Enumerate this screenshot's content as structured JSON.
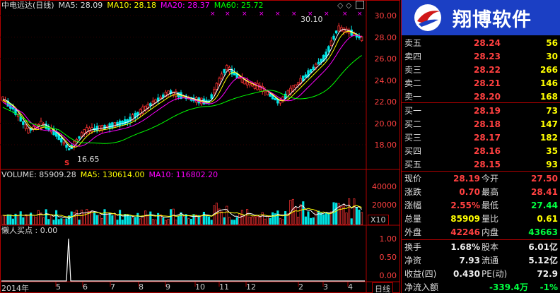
{
  "header": {
    "stock_name": "中电远达(日线)",
    "ma5": "MA5: 28.09",
    "ma10": "MA10: 28.18",
    "ma20": "MA20: 28.37",
    "ma60": "MA60: 25.72"
  },
  "price_axis": [
    "30.00",
    "28.00",
    "26.00",
    "24.00",
    "22.00",
    "20.00",
    "18.00"
  ],
  "annotations": {
    "high": "30.10",
    "low": "16.65",
    "marker": "S"
  },
  "volume_header": {
    "volume": "VOLUME: 85909.28",
    "ma5": "MA5: 130614.00",
    "ma10": "MA10: 116802.20"
  },
  "volume_axis": [
    "40000",
    "20000"
  ],
  "x10_tab": "X10",
  "indicator_header": "懒人买点 : 0.00",
  "indicator_axis": [
    "1.00",
    "0.50",
    "0.00"
  ],
  "time_axis": [
    "2014年",
    "5",
    "6",
    "7",
    "8",
    "9",
    "10",
    "11",
    "12",
    "2",
    "3",
    "4"
  ],
  "daily_tab": "日线",
  "logo_text": "翔博软件",
  "order_book": {
    "asks": [
      {
        "label": "卖五",
        "price": "28.24",
        "volume": "56"
      },
      {
        "label": "卖四",
        "price": "28.23",
        "volume": "30"
      },
      {
        "label": "卖三",
        "price": "28.22",
        "volume": "266"
      },
      {
        "label": "卖二",
        "price": "28.21",
        "volume": "146"
      },
      {
        "label": "卖一",
        "price": "28.20",
        "volume": "168"
      }
    ],
    "bids": [
      {
        "label": "买一",
        "price": "28.19",
        "volume": "73"
      },
      {
        "label": "买二",
        "price": "28.18",
        "volume": "147"
      },
      {
        "label": "买三",
        "price": "28.17",
        "volume": "182"
      },
      {
        "label": "买四",
        "price": "28.16",
        "volume": "35"
      },
      {
        "label": "买五",
        "price": "28.15",
        "volume": "93"
      }
    ]
  },
  "quote": [
    {
      "l1": "现价",
      "v1": "28.19",
      "c1": "red",
      "l2": "今开",
      "v2": "27.50",
      "c2": "red"
    },
    {
      "l1": "涨跌",
      "v1": "0.70",
      "c1": "red",
      "l2": "最高",
      "v2": "28.41",
      "c2": "red"
    },
    {
      "l1": "涨幅",
      "v1": "2.55%",
      "c1": "red",
      "l2": "最低",
      "v2": "27.44",
      "c2": "grn"
    },
    {
      "l1": "总量",
      "v1": "85909",
      "c1": "yel",
      "l2": "量比",
      "v2": "0.61",
      "c2": "yel"
    },
    {
      "l1": "外盘",
      "v1": "42246",
      "c1": "red",
      "l2": "内盘",
      "v2": "43663",
      "c2": "grn"
    }
  ],
  "fundamentals": [
    {
      "l1": "换手",
      "v1": "1.68%",
      "l2": "股本",
      "v2": "6.01亿"
    },
    {
      "l1": "净资",
      "v1": "7.93",
      "l2": "流通",
      "v2": "5.12亿"
    },
    {
      "l1": "收益(四)",
      "v1": "0.430",
      "l2": "PE(动)",
      "v2": "72.9"
    }
  ],
  "net_inflow": {
    "label": "净流入额",
    "value": "-339.4万",
    "pct": "-1%"
  },
  "colors": {
    "up": "#ff4040",
    "down": "#00ffff",
    "ma5": "#ffffff",
    "ma10": "#ffff00",
    "ma20": "#ff00ff",
    "ma60": "#00ff00",
    "border": "#b00000"
  }
}
